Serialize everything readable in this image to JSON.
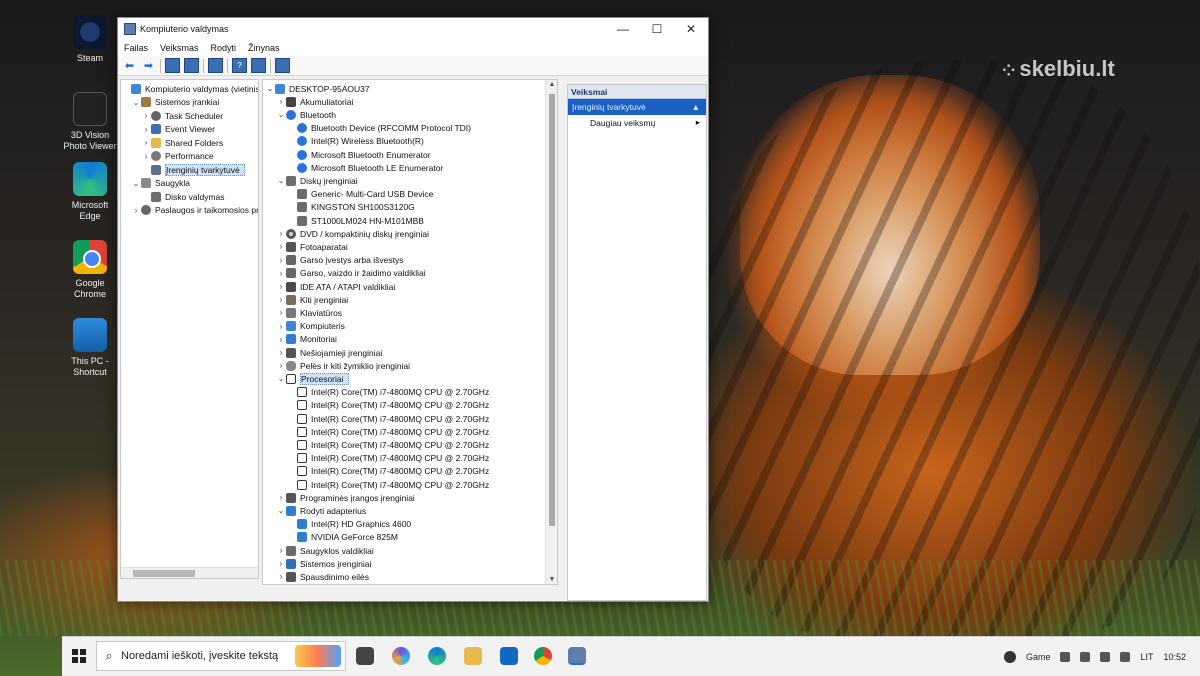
{
  "watermark": "skelbiu.lt",
  "desktop_icons": [
    {
      "label": "Steam",
      "icon": "steam-icon"
    },
    {
      "label": "3D Vision Photo Viewer",
      "icon": "3d-vision-icon"
    },
    {
      "label": "Microsoft Edge",
      "icon": "edge-icon"
    },
    {
      "label": "Google Chrome",
      "icon": "chrome-icon"
    },
    {
      "label": "This PC - Shortcut",
      "icon": "this-pc-icon"
    }
  ],
  "window": {
    "title": "Kompiuterio valdymas",
    "controls": {
      "minimize": "—",
      "maximize": "☐",
      "close": "✕"
    },
    "menu": [
      "Failas",
      "Veiksmas",
      "Rodyti",
      "Žinynas"
    ]
  },
  "left_tree": [
    {
      "label": "Kompiuterio valdymas (vietinis",
      "level": 0,
      "chev": "",
      "icon": "ic-pc"
    },
    {
      "label": "Sistemos įrankiai",
      "level": 1,
      "chev": "v",
      "icon": "ic-tool"
    },
    {
      "label": "Task Scheduler",
      "level": 2,
      "chev": ">",
      "icon": "ic-gear"
    },
    {
      "label": "Event Viewer",
      "level": 2,
      "chev": ">",
      "icon": "ic-ev"
    },
    {
      "label": "Shared Folders",
      "level": 2,
      "chev": ">",
      "icon": "ic-folder"
    },
    {
      "label": "Performance",
      "level": 2,
      "chev": ">",
      "icon": "ic-perf"
    },
    {
      "label": "Įrenginių tvarkytuvė",
      "level": 2,
      "chev": "",
      "icon": "ic-dm",
      "selected": true
    },
    {
      "label": "Saugykla",
      "level": 1,
      "chev": "v",
      "icon": "ic-store"
    },
    {
      "label": "Disko valdymas",
      "level": 2,
      "chev": "",
      "icon": "ic-disk"
    },
    {
      "label": "Paslaugos ir taikomosios pr",
      "level": 1,
      "chev": ">",
      "icon": "ic-gear"
    }
  ],
  "device_tree": [
    {
      "label": "DESKTOP-95AOU37",
      "level": 0,
      "chev": "v",
      "icon": "ic-pc"
    },
    {
      "label": "Akumuliatoriai",
      "level": 1,
      "chev": ">",
      "icon": "ic-bat"
    },
    {
      "label": "Bluetooth",
      "level": 1,
      "chev": "v",
      "icon": "ic-bt"
    },
    {
      "label": "Bluetooth Device (RFCOMM Protocol TDI)",
      "level": 2,
      "chev": "",
      "icon": "ic-bt"
    },
    {
      "label": "Intel(R) Wireless Bluetooth(R)",
      "level": 2,
      "chev": "",
      "icon": "ic-bt"
    },
    {
      "label": "Microsoft Bluetooth Enumerator",
      "level": 2,
      "chev": "",
      "icon": "ic-bt"
    },
    {
      "label": "Microsoft Bluetooth LE Enumerator",
      "level": 2,
      "chev": "",
      "icon": "ic-bt"
    },
    {
      "label": "Diskų įrenginiai",
      "level": 1,
      "chev": "v",
      "icon": "ic-disk"
    },
    {
      "label": "Generic- Multi-Card USB Device",
      "level": 2,
      "chev": "",
      "icon": "ic-disk"
    },
    {
      "label": "KINGSTON SH100S3120G",
      "level": 2,
      "chev": "",
      "icon": "ic-disk"
    },
    {
      "label": "ST1000LM024 HN-M101MBB",
      "level": 2,
      "chev": "",
      "icon": "ic-disk"
    },
    {
      "label": "DVD / kompaktinių diskų įrenginiai",
      "level": 1,
      "chev": ">",
      "icon": "ic-dvd"
    },
    {
      "label": "Fotoaparatai",
      "level": 1,
      "chev": ">",
      "icon": "ic-cam"
    },
    {
      "label": "Garso įvestys arba išvestys",
      "level": 1,
      "chev": ">",
      "icon": "ic-snd"
    },
    {
      "label": "Garso, vaizdo ir žaidimo valdikliai",
      "level": 1,
      "chev": ">",
      "icon": "ic-snd"
    },
    {
      "label": "IDE ATA / ATAPI valdikliai",
      "level": 1,
      "chev": ">",
      "icon": "ic-ide"
    },
    {
      "label": "Kiti įrenginiai",
      "level": 1,
      "chev": ">",
      "icon": "ic-oth"
    },
    {
      "label": "Klaviatūros",
      "level": 1,
      "chev": ">",
      "icon": "ic-kb"
    },
    {
      "label": "Kompiuteris",
      "level": 1,
      "chev": ">",
      "icon": "ic-pc"
    },
    {
      "label": "Monitoriai",
      "level": 1,
      "chev": ">",
      "icon": "ic-mon"
    },
    {
      "label": "Nešiojamieji įrenginiai",
      "level": 1,
      "chev": ">",
      "icon": "ic-usb"
    },
    {
      "label": "Pelės ir kiti žymiklio įrenginiai",
      "level": 1,
      "chev": ">",
      "icon": "ic-mouse"
    },
    {
      "label": "Procesoriai",
      "level": 1,
      "chev": "v",
      "icon": "ic-cpu",
      "selected": true
    },
    {
      "label": "Intel(R) Core(TM) i7-4800MQ CPU @ 2.70GHz",
      "level": 2,
      "chev": "",
      "icon": "ic-cpu"
    },
    {
      "label": "Intel(R) Core(TM) i7-4800MQ CPU @ 2.70GHz",
      "level": 2,
      "chev": "",
      "icon": "ic-cpu"
    },
    {
      "label": "Intel(R) Core(TM) i7-4800MQ CPU @ 2.70GHz",
      "level": 2,
      "chev": "",
      "icon": "ic-cpu"
    },
    {
      "label": "Intel(R) Core(TM) i7-4800MQ CPU @ 2.70GHz",
      "level": 2,
      "chev": "",
      "icon": "ic-cpu"
    },
    {
      "label": "Intel(R) Core(TM) i7-4800MQ CPU @ 2.70GHz",
      "level": 2,
      "chev": "",
      "icon": "ic-cpu"
    },
    {
      "label": "Intel(R) Core(TM) i7-4800MQ CPU @ 2.70GHz",
      "level": 2,
      "chev": "",
      "icon": "ic-cpu"
    },
    {
      "label": "Intel(R) Core(TM) i7-4800MQ CPU @ 2.70GHz",
      "level": 2,
      "chev": "",
      "icon": "ic-cpu"
    },
    {
      "label": "Intel(R) Core(TM) i7-4800MQ CPU @ 2.70GHz",
      "level": 2,
      "chev": "",
      "icon": "ic-cpu"
    },
    {
      "label": "Programinės įrangos įrenginiai",
      "level": 1,
      "chev": ">",
      "icon": "ic-fw"
    },
    {
      "label": "Rodyti adapterius",
      "level": 1,
      "chev": "v",
      "icon": "ic-gpu"
    },
    {
      "label": "Intel(R) HD Graphics 4600",
      "level": 2,
      "chev": "",
      "icon": "ic-gpu"
    },
    {
      "label": "NVIDIA GeForce 825M",
      "level": 2,
      "chev": "",
      "icon": "ic-gpu"
    },
    {
      "label": "Saugyklos valdikliai",
      "level": 1,
      "chev": ">",
      "icon": "ic-sec"
    },
    {
      "label": "Sistemos įrenginiai",
      "level": 1,
      "chev": ">",
      "icon": "ic-sys"
    },
    {
      "label": "Spausdinimo eilės",
      "level": 1,
      "chev": ">",
      "icon": "ic-fw"
    }
  ],
  "actions": {
    "header": "Veiksmai",
    "section": "Įrenginių tvarkytuvė",
    "more": "Daugiau veiksmų"
  },
  "taskbar": {
    "search_placeholder": "Noredami ieškoti, įveskite tekstą",
    "apps": [
      "task-view-icon",
      "copilot-icon",
      "edge-icon",
      "file-explorer-icon",
      "outlook-icon",
      "chrome-icon",
      "computer-management-icon"
    ],
    "tray_game": "Game",
    "lang": "LIT",
    "time": "10:52"
  }
}
